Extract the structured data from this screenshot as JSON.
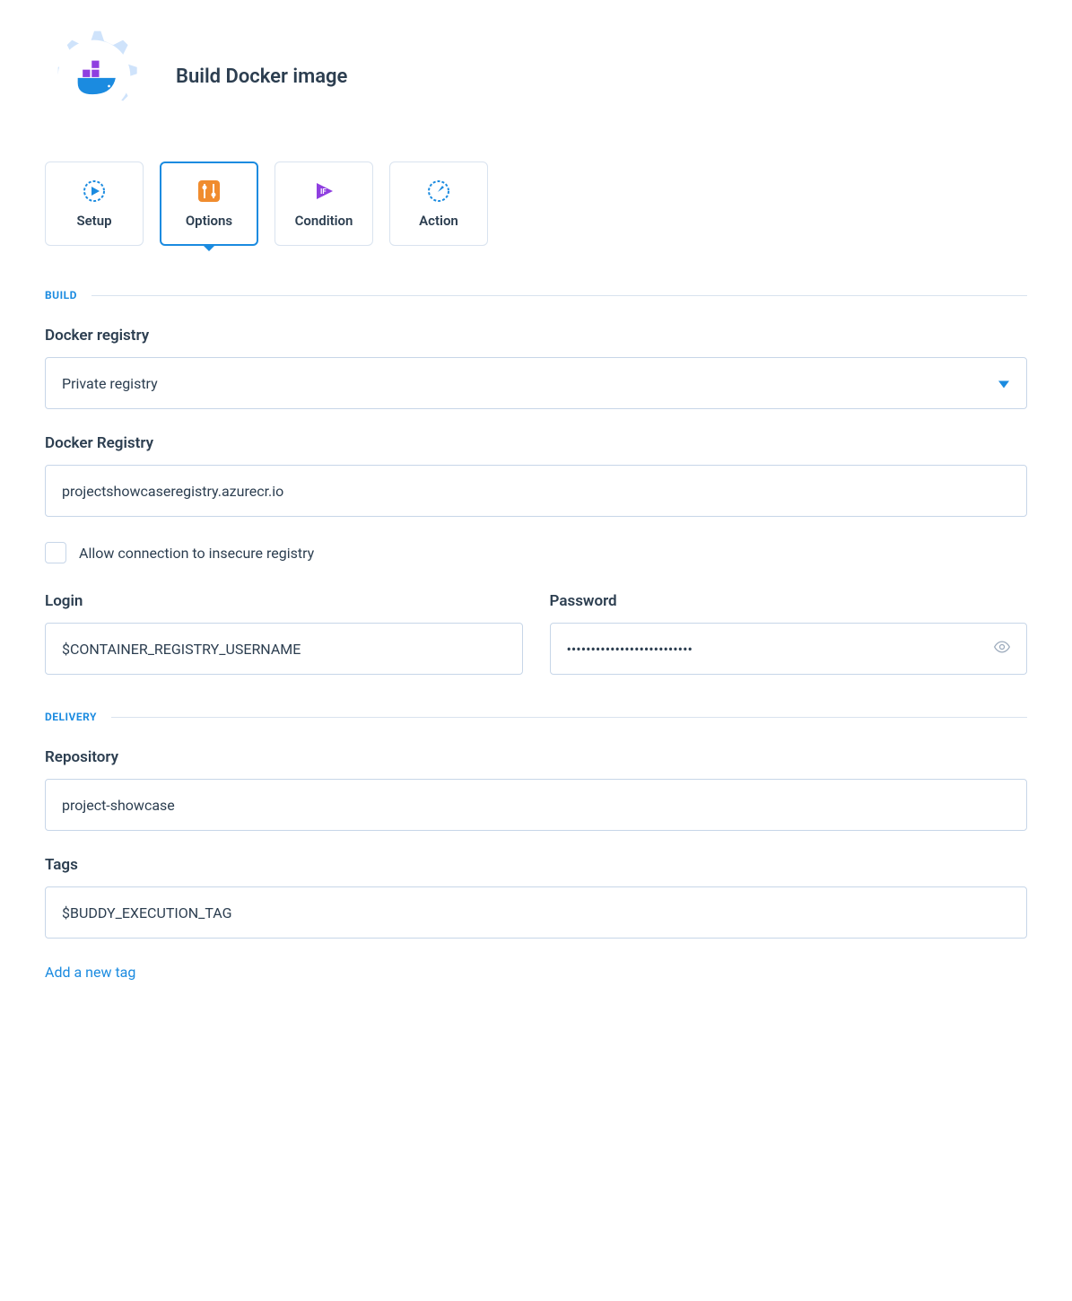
{
  "header": {
    "title": "Build Docker image"
  },
  "tabs": [
    {
      "id": "setup",
      "label": "Setup"
    },
    {
      "id": "options",
      "label": "Options",
      "active": true
    },
    {
      "id": "condition",
      "label": "Condition"
    },
    {
      "id": "action",
      "label": "Action"
    }
  ],
  "sections": {
    "build": {
      "heading": "BUILD",
      "docker_registry_label": "Docker registry",
      "docker_registry_value": "Private registry",
      "docker_registry_url_label": "Docker Registry",
      "docker_registry_url_value": "projectshowcaseregistry.azurecr.io",
      "insecure_checkbox_label": "Allow connection to insecure registry",
      "insecure_checkbox_checked": false,
      "login_label": "Login",
      "login_value": "$CONTAINER_REGISTRY_USERNAME",
      "password_label": "Password",
      "password_value": "••••••••••••••••••••••••••"
    },
    "delivery": {
      "heading": "DELIVERY",
      "repository_label": "Repository",
      "repository_value": "project-showcase",
      "tags_label": "Tags",
      "tags_value": "$BUDDY_EXECUTION_TAG",
      "add_tag_label": "Add a new tag"
    }
  }
}
